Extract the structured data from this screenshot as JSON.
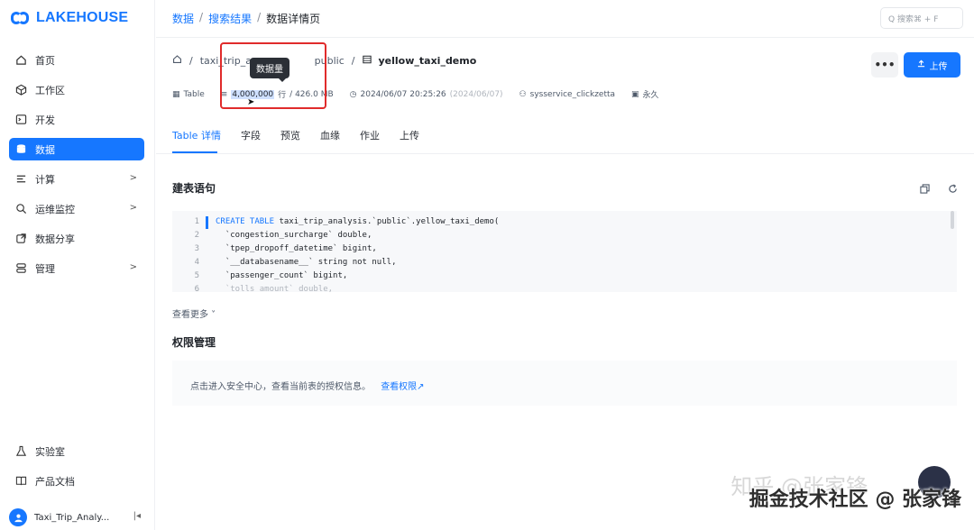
{
  "app": {
    "logo_text": "LAKEHOUSE",
    "brand_color": "#1677ff"
  },
  "sidebar": {
    "items": [
      {
        "label": "首页",
        "icon": "home-icon"
      },
      {
        "label": "工作区",
        "icon": "cube-icon"
      },
      {
        "label": "开发",
        "icon": "terminal-icon"
      },
      {
        "label": "数据",
        "icon": "database-icon",
        "active": true
      },
      {
        "label": "计算",
        "icon": "list-icon",
        "chevron": ">"
      },
      {
        "label": "运维监控",
        "icon": "monitor-icon",
        "chevron": ">"
      },
      {
        "label": "数据分享",
        "icon": "share-icon"
      },
      {
        "label": "管理",
        "icon": "manage-icon",
        "chevron": ">"
      }
    ],
    "bottom_items": [
      {
        "label": "实验室",
        "icon": "flask-icon"
      },
      {
        "label": "产品文档",
        "icon": "book-icon"
      }
    ],
    "project": {
      "name": "Taxi_Trip_Analy...",
      "collapse": "|◂"
    }
  },
  "header": {
    "breadcrumb": [
      "数据",
      "搜索结果",
      "数据详情页"
    ],
    "search_placeholder": "Q 搜索⌘ + F"
  },
  "table_path": {
    "segments": [
      "taxi_trip_ana",
      "public"
    ],
    "table_name": "yellow_taxi_demo"
  },
  "meta": {
    "type": "Table",
    "rows": "4,000,000",
    "rows_unit": "行",
    "size": "/ 426.0 MB",
    "created": "2024/06/07 20:25:26",
    "created_muted": "(2024/06/07)",
    "owner": "sysservice_clickzetta",
    "lifecycle": "永久"
  },
  "tooltip": "数据量",
  "actions": {
    "more": "•••",
    "upload": "上传"
  },
  "tabs": [
    "Table 详情",
    "字段",
    "预览",
    "血缘",
    "作业",
    "上传"
  ],
  "ddl": {
    "title": "建表语句",
    "lines": [
      {
        "n": "1",
        "kw": "CREATE TABLE",
        "rest": " taxi_trip_analysis.`public`.yellow_taxi_demo("
      },
      {
        "n": "2",
        "kw": "",
        "rest": "  `congestion_surcharge` double,"
      },
      {
        "n": "3",
        "kw": "",
        "rest": "  `tpep_dropoff_datetime` bigint,"
      },
      {
        "n": "4",
        "kw": "",
        "rest": "  `__databasename__` string not null,"
      },
      {
        "n": "5",
        "kw": "",
        "rest": "  `passenger_count` bigint,"
      },
      {
        "n": "6",
        "kw": "",
        "rest": "  `tolls_amount` double,"
      }
    ],
    "see_more": "查看更多 ˅"
  },
  "permission": {
    "title": "权限管理",
    "text": "点击进入安全中心，查看当前表的授权信息。",
    "link": "查看权限↗"
  },
  "watermark": {
    "main": "掘金技术社区 @ 张家锋",
    "faint": "知乎 @张家锋"
  }
}
